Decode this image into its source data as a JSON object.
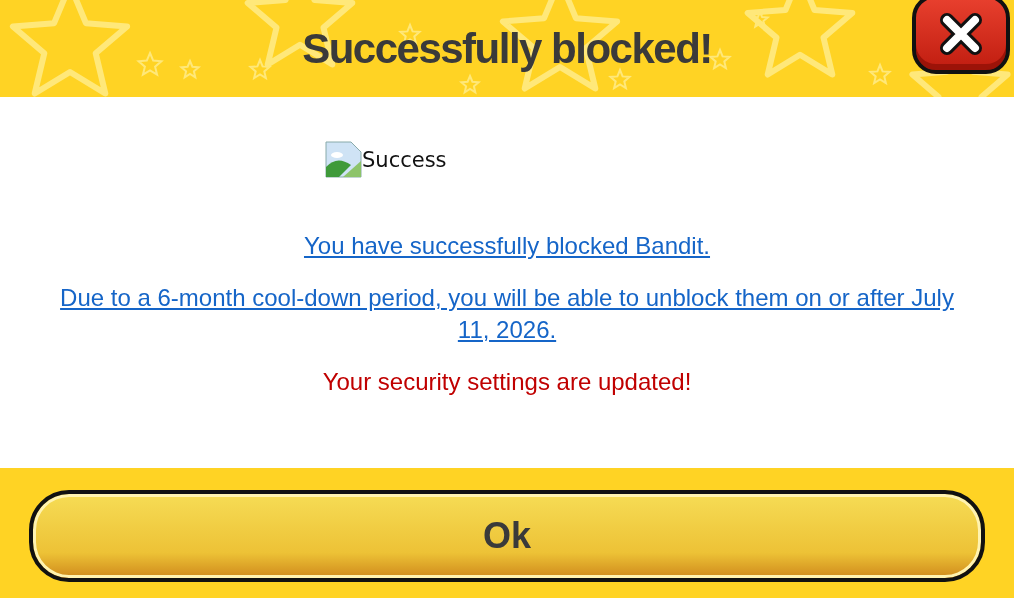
{
  "header": {
    "title": "Successfully blocked!"
  },
  "image": {
    "alt": "Success"
  },
  "messages": [
    {
      "kind": "link",
      "text": "You have successfully blocked Bandit."
    },
    {
      "kind": "link",
      "text": "Due to a 6-month cool-down period, you will be able to unblock them on or after July 11, 2026."
    },
    {
      "kind": "alert",
      "text": "Your security settings are updated!"
    }
  ],
  "button": {
    "label": "Ok"
  }
}
